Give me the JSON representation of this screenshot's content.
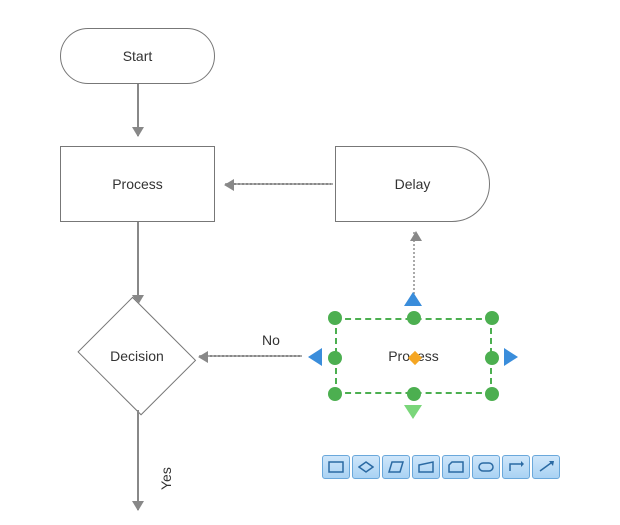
{
  "chart_data": {
    "type": "flowchart",
    "nodes": [
      {
        "id": "start",
        "kind": "terminator",
        "label": "Start"
      },
      {
        "id": "proc1",
        "kind": "process",
        "label": "Process"
      },
      {
        "id": "delay",
        "kind": "delay",
        "label": "Delay"
      },
      {
        "id": "dec",
        "kind": "decision",
        "label": "Decision"
      },
      {
        "id": "proc2",
        "kind": "process",
        "label": "Process",
        "selected": true
      }
    ],
    "edges": [
      {
        "from": "start",
        "to": "proc1",
        "style": "solid"
      },
      {
        "from": "proc1",
        "to": "dec",
        "style": "solid"
      },
      {
        "from": "dec",
        "to": "proc2",
        "style": "dotted",
        "label": "No"
      },
      {
        "from": "proc2",
        "to": "delay",
        "style": "dotted"
      },
      {
        "from": "delay",
        "to": "proc1",
        "style": "dotted"
      },
      {
        "from": "dec",
        "to": "down",
        "style": "solid",
        "label": "Yes"
      }
    ]
  },
  "labels": {
    "start": "Start",
    "process1": "Process",
    "delay": "Delay",
    "decision": "Decision",
    "process2": "Process",
    "no": "No",
    "yes": "Yes"
  },
  "toolbar": {
    "items": [
      {
        "name": "process-shape"
      },
      {
        "name": "decision-shape"
      },
      {
        "name": "data-shape"
      },
      {
        "name": "manual-input-shape"
      },
      {
        "name": "card-shape"
      },
      {
        "name": "terminator-shape"
      },
      {
        "name": "l-connector"
      },
      {
        "name": "straight-connector"
      }
    ]
  }
}
